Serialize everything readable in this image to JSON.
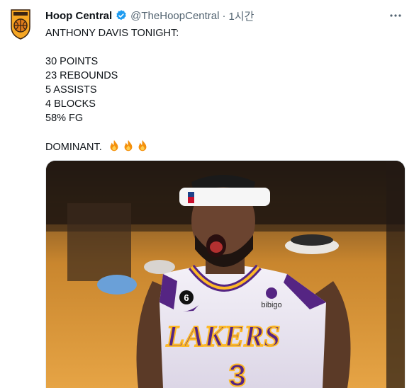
{
  "author": {
    "name": "Hoop Central",
    "handle": "@TheHoopCentral",
    "separator": "·",
    "time": "1시간",
    "verified": true,
    "avatar_icon": "hoop-central-shield-logo"
  },
  "more_icon": "more-horizontal-icon",
  "tweet": {
    "headline": "ANTHONY DAVIS TONIGHT:",
    "stats": [
      "30 POINTS",
      "23 REBOUNDS",
      "5 ASSISTS",
      "4 BLOCKS",
      "58% FG"
    ],
    "closing": "DOMINANT.",
    "closing_emoji": "fire-emoji x3"
  },
  "media": {
    "jersey_text": "LAKERS",
    "jersey_number": "3",
    "collar_number": "6",
    "sponsor": "bibigo"
  },
  "colors": {
    "verified_blue": "#1d9bf0",
    "secondary_text": "#536471",
    "primary_text": "#0f1419",
    "lakers_purple": "#552583",
    "lakers_gold": "#fdb927"
  }
}
